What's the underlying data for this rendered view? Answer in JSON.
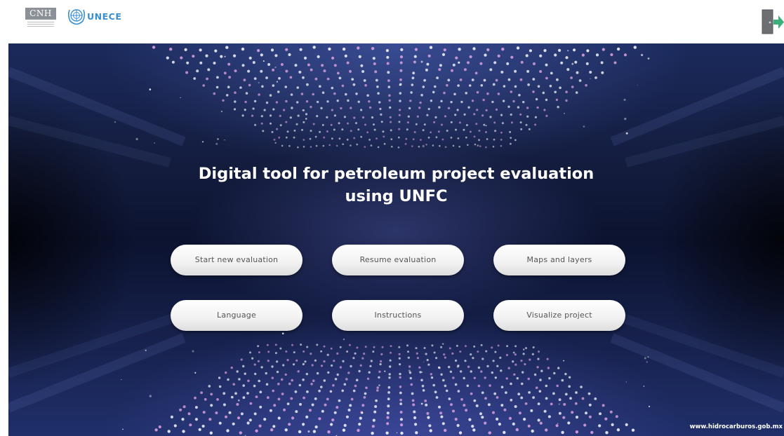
{
  "header": {
    "cnh_logo_text": "CNH",
    "unece_logo_text": "UNECE"
  },
  "main": {
    "title_line1": "Digital tool for petroleum project evaluation",
    "title_line2": "using UNFC",
    "buttons": [
      {
        "label": "Start new evaluation"
      },
      {
        "label": "Resume evaluation"
      },
      {
        "label": "Maps and layers"
      },
      {
        "label": "Language"
      },
      {
        "label": "Instructions"
      },
      {
        "label": "Visualize project"
      }
    ],
    "website": "www.hidrocarburos.gob.mx"
  },
  "icons": {
    "exit": "exit-door-icon",
    "un_emblem": "un-emblem-icon"
  },
  "colors": {
    "background_dark": "#0c1330",
    "accent_blue": "#3a8fd0",
    "exit_green": "#3db07a",
    "button_face": "#f1f1f1"
  }
}
